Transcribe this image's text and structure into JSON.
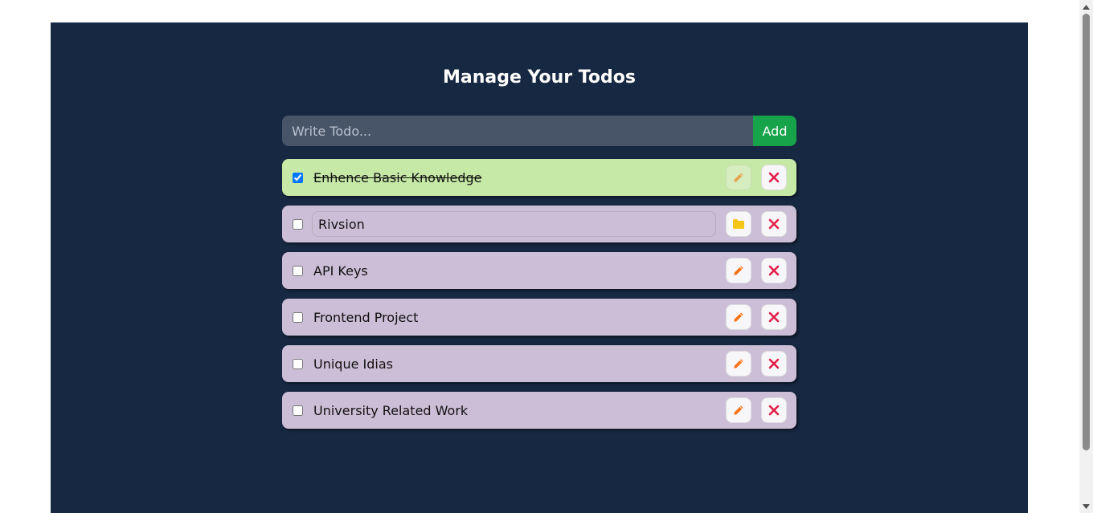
{
  "app": {
    "title": "Manage Your Todos"
  },
  "form": {
    "placeholder": "Write Todo...",
    "value": "",
    "add_label": "Add"
  },
  "todos": [
    {
      "text": "Enhence Basic Knowledge",
      "completed": true,
      "editing": false
    },
    {
      "text": "Rivsion",
      "completed": false,
      "editing": true
    },
    {
      "text": "API Keys",
      "completed": false,
      "editing": false
    },
    {
      "text": "Frontend Project",
      "completed": false,
      "editing": false
    },
    {
      "text": "Unique Idias",
      "completed": false,
      "editing": false
    },
    {
      "text": "University Related Work",
      "completed": false,
      "editing": false
    }
  ],
  "icons": {
    "edit": "pencil-icon",
    "save": "folder-icon",
    "delete": "close-icon"
  },
  "colors": {
    "panel": "#172842",
    "add_button": "#16a34a",
    "item_pending": "#ccbed7",
    "item_done": "#c6e9a7",
    "delete_icon": "#e11d48",
    "edit_icon": "#f97316",
    "save_icon": "#f5c518"
  }
}
